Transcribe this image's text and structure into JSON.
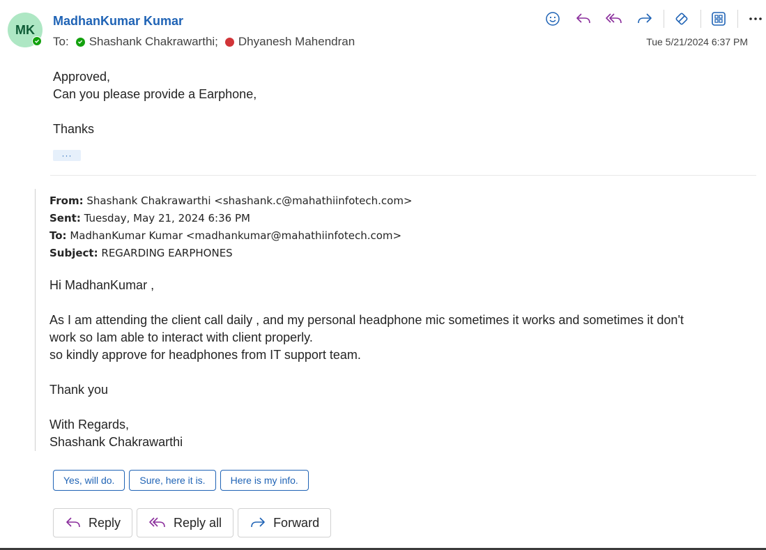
{
  "sender": {
    "initials": "MK",
    "name": "MadhanKumar Kumar",
    "to_label": "To:",
    "recipients": [
      {
        "name": "Shashank Chakrawarthi;",
        "status": "available"
      },
      {
        "name": "Dhyanesh Mahendran",
        "status": "busy"
      }
    ],
    "date": "Tue 5/21/2024 6:37 PM"
  },
  "toolbar": {
    "icons": [
      "emoji-icon",
      "reply-icon",
      "reply-all-icon",
      "forward-icon",
      "sensitivity-icon",
      "apps-icon",
      "more-icon"
    ]
  },
  "message": {
    "lines": [
      "Approved,",
      "Can you please provide a Earphone,",
      "",
      "Thanks"
    ],
    "expand_label": "···"
  },
  "quoted": {
    "from_label": "From:",
    "from_value": "Shashank Chakrawarthi <shashank.c@mahathiinfotech.com>",
    "sent_label": "Sent:",
    "sent_value": "Tuesday, May 21, 2024 6:36 PM",
    "to_label": "To:",
    "to_value": "MadhanKumar Kumar <madhankumar@mahathiinfotech.com>",
    "subject_label": "Subject:",
    "subject_value": "REGARDING EARPHONES",
    "greeting": "Hi MadhanKumar ,",
    "para1_line1": "As I am attending the client call daily , and my personal headphone mic sometimes it works and sometimes it don't",
    "para1_line2": "work so Iam able to interact with client properly.",
    "para1_line3": "so kindly approve for headphones from IT support team.",
    "thanks": "Thank you",
    "regards": "With Regards,",
    "signature": "Shashank Chakrawarthi"
  },
  "suggested_replies": [
    "Yes, will do.",
    "Sure, here it is.",
    "Here is my info."
  ],
  "actions": {
    "reply": "Reply",
    "reply_all": "Reply all",
    "forward": "Forward"
  },
  "colors": {
    "accent": "#1f63b5",
    "avatar_bg": "#aee7c4",
    "available": "#13a10e",
    "busy": "#d13438",
    "reply_all_icon": "#8a2d9c"
  }
}
